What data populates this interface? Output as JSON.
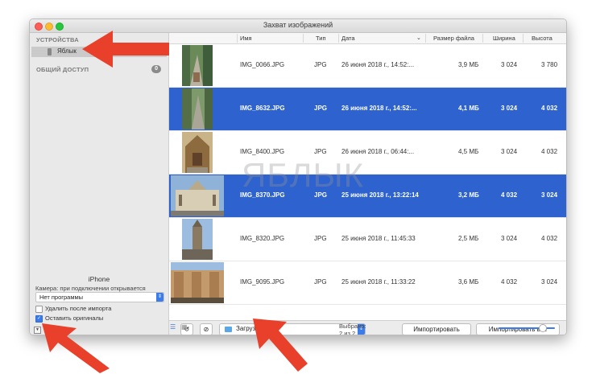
{
  "window": {
    "title": "Захват изображений"
  },
  "sidebar": {
    "devices_header": "УСТРОЙСТВА",
    "device_name": "Яблык",
    "shared_header": "ОБЩИЙ ДОСТУП",
    "shared_count": "0",
    "device_title": "iPhone",
    "camera_label": "Камера: при подключении открывается",
    "camera_app": "Нет программы",
    "delete_after_import": "Удалить после импорта",
    "keep_originals": "Оставить оригиналы"
  },
  "columns": [
    "Имя",
    "Тип",
    "Дата",
    "Размер файла",
    "Ширина",
    "Высота"
  ],
  "rows": [
    {
      "name": "IMG_0066.JPG",
      "type": "JPG",
      "date": "26 июня 2018 г., 14:52:...",
      "size": "3,9 МБ",
      "width": "3 024",
      "height": "3 780",
      "selected": false
    },
    {
      "name": "IMG_8632.JPG",
      "type": "JPG",
      "date": "26 июня 2018 г., 14:52:...",
      "size": "4,1 МБ",
      "width": "3 024",
      "height": "4 032",
      "selected": true
    },
    {
      "name": "IMG_8400.JPG",
      "type": "JPG",
      "date": "26 июня 2018 г., 06:44:...",
      "size": "4,5 МБ",
      "width": "3 024",
      "height": "4 032",
      "selected": false
    },
    {
      "name": "IMG_8370.JPG",
      "type": "JPG",
      "date": "25 июня 2018 г., 13:22:14",
      "size": "3,2 МБ",
      "width": "4 032",
      "height": "3 024",
      "selected": true
    },
    {
      "name": "IMG_8320.JPG",
      "type": "JPG",
      "date": "25 июня 2018 г., 11:45:33",
      "size": "2,5 МБ",
      "width": "3 024",
      "height": "4 032",
      "selected": false
    },
    {
      "name": "IMG_9095.JPG",
      "type": "JPG",
      "date": "25 июня 2018 г., 11:33:22",
      "size": "3,6 МБ",
      "width": "4 032",
      "height": "3 024",
      "selected": false
    }
  ],
  "toolbar": {
    "import_to": "Загрузки",
    "import_button": "Импортировать",
    "import_all_button": "Импортировать все",
    "status": "Выбрано: 2 из 2 856"
  },
  "watermark": "ЯБЛЫК",
  "colors": {
    "selection": "#2d62cf",
    "arrow": "#e8402a",
    "accent": "#3b7bea"
  },
  "icons": [
    "phone-icon",
    "rotate-icon",
    "delete-icon",
    "folder-icon",
    "chevron-updown-icon",
    "list-view-icon",
    "grid-view-icon"
  ]
}
